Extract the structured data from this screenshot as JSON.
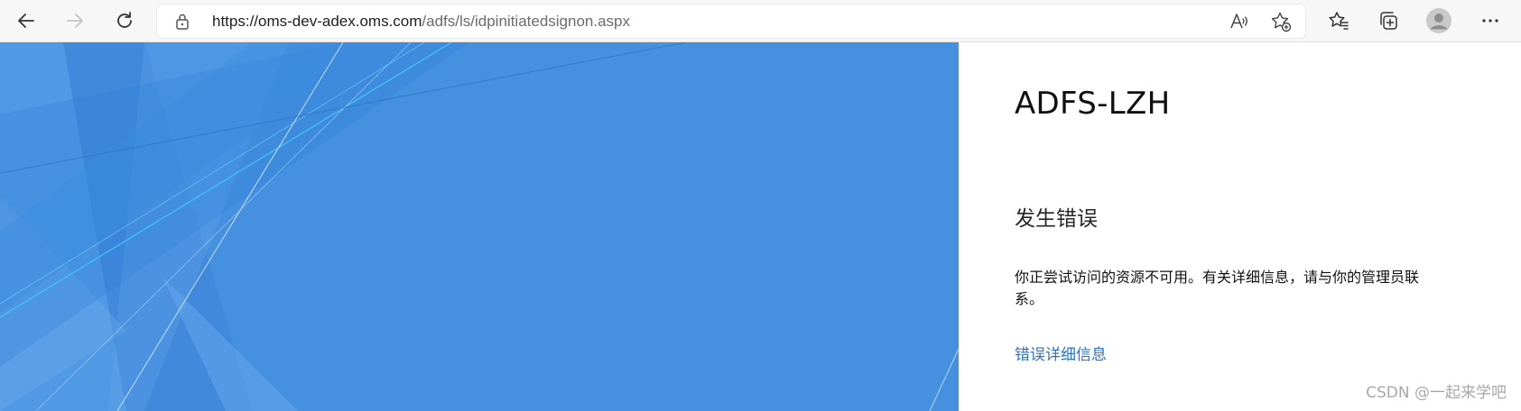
{
  "browser": {
    "url_host": "https://oms-dev-adex.oms.com",
    "url_path": "/adfs/ls/idpinitiatedsignon.aspx",
    "icons": [
      "back-icon",
      "forward-icon",
      "refresh-icon",
      "lock-icon",
      "read-aloud-icon",
      "add-favorite-icon",
      "favorites-icon",
      "collections-icon",
      "profile-icon",
      "more-icon"
    ]
  },
  "page": {
    "org_name": "ADFS-LZH",
    "error_title": "发生错误",
    "error_message": "你正尝试访问的资源不可用。有关详细信息，请与你的管理员联系。",
    "error_details_link": "错误详细信息"
  },
  "watermark": "CSDN @一起来学吧",
  "colors": {
    "illustration_bg": "#4590df",
    "link": "#2b72c4",
    "toolbar_bg": "#f7f7f7"
  }
}
